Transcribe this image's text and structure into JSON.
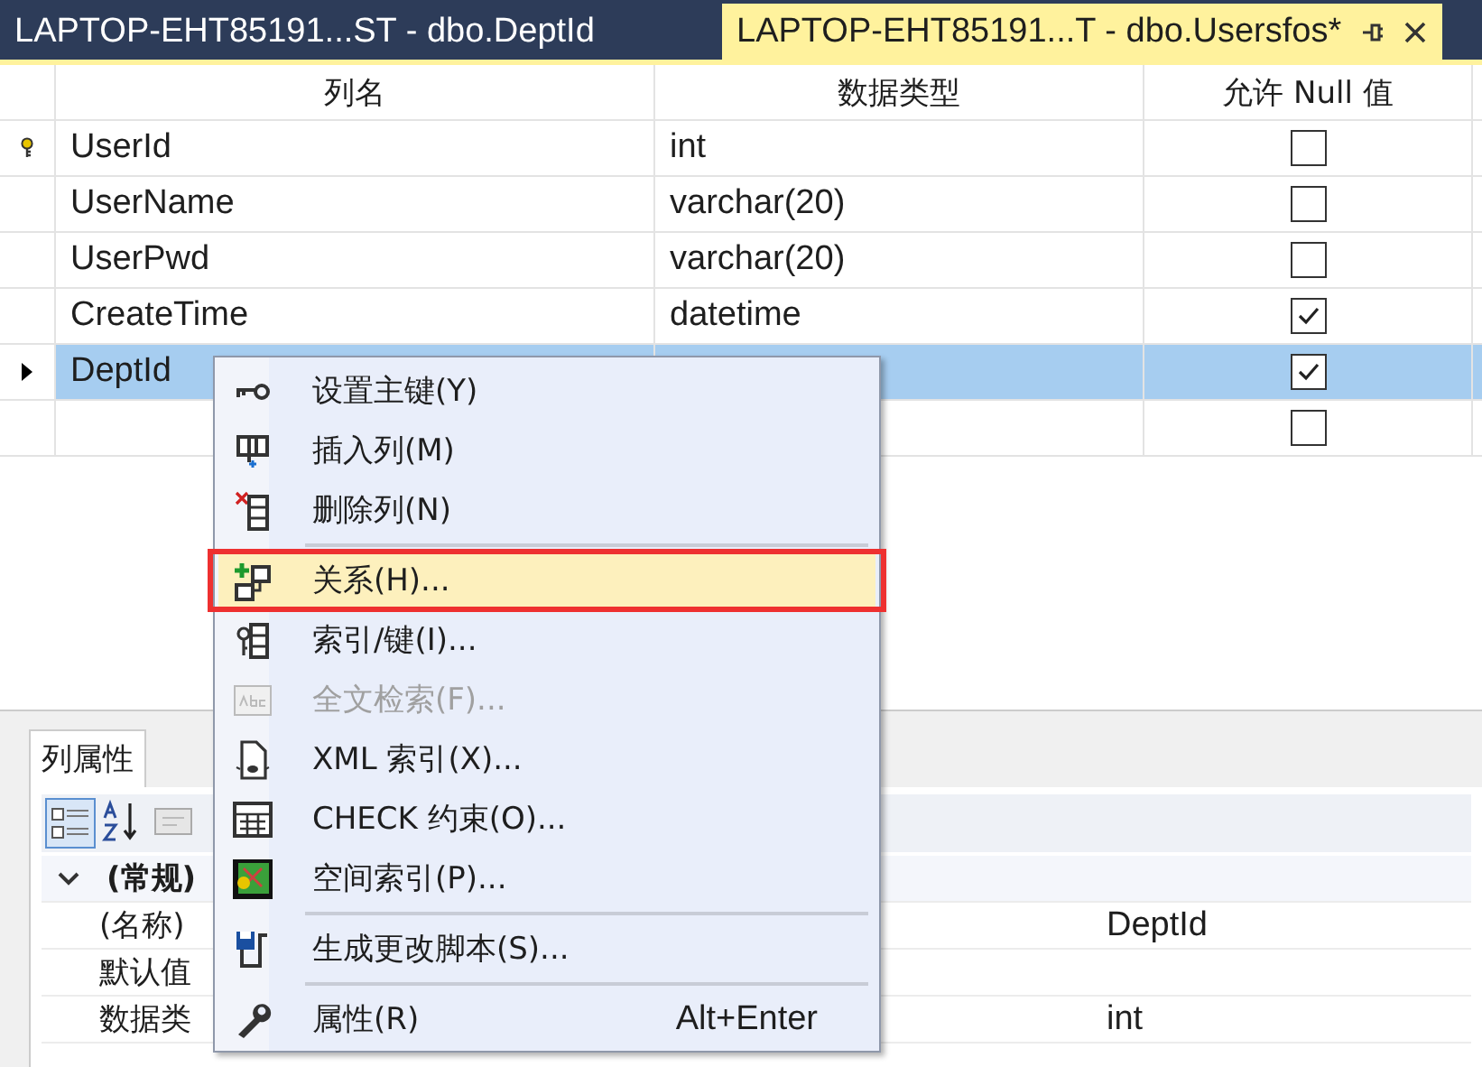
{
  "tabs": [
    {
      "label": "LAPTOP-EHT85191...ST - dbo.DeptId",
      "selected": false
    },
    {
      "label": "LAPTOP-EHT85191...T - dbo.Usersfos*",
      "selected": true
    }
  ],
  "table": {
    "columns": [
      "列名",
      "数据类型",
      "允许 Null 值"
    ],
    "rows": [
      {
        "name": "UserId",
        "type": "int",
        "allow_null": false,
        "primary_key": true,
        "current": false,
        "selected": false
      },
      {
        "name": "UserName",
        "type": "varchar(20)",
        "allow_null": false,
        "primary_key": false,
        "current": false,
        "selected": false
      },
      {
        "name": "UserPwd",
        "type": "varchar(20)",
        "allow_null": false,
        "primary_key": false,
        "current": false,
        "selected": false
      },
      {
        "name": "CreateTime",
        "type": "datetime",
        "allow_null": true,
        "primary_key": false,
        "current": false,
        "selected": false
      },
      {
        "name": "DeptId",
        "allow_null": true,
        "primary_key": false,
        "current": true,
        "selected": true
      },
      {
        "allow_null": false,
        "primary_key": false,
        "current": false,
        "selected": false
      }
    ]
  },
  "properties": {
    "tab": "列属性",
    "rows": [
      {
        "kind": "category",
        "label": "(常规)",
        "expanded": true
      },
      {
        "kind": "property",
        "label": "(名称)",
        "value": "DeptId"
      },
      {
        "kind": "property",
        "label": "默认值"
      },
      {
        "kind": "property",
        "label": "数据类",
        "value": "int"
      }
    ]
  },
  "context_menu": {
    "items": [
      {
        "kind": "item",
        "label": "设置主键(Y)",
        "disabled": false,
        "highlighted": false,
        "outlined": false
      },
      {
        "kind": "item",
        "label": "插入列(M)",
        "disabled": false,
        "highlighted": false,
        "outlined": false
      },
      {
        "kind": "item",
        "label": "删除列(N)",
        "disabled": false,
        "highlighted": false,
        "outlined": false
      },
      {
        "kind": "separator"
      },
      {
        "kind": "item",
        "label": "关系(H)...",
        "disabled": false,
        "highlighted": true,
        "outlined": true
      },
      {
        "kind": "item",
        "label": "索引/键(I)...",
        "disabled": false,
        "highlighted": false,
        "outlined": false
      },
      {
        "kind": "item",
        "label": "全文检索(F)...",
        "disabled": true,
        "highlighted": false,
        "outlined": false
      },
      {
        "kind": "item",
        "label": "XML 索引(X)...",
        "disabled": false,
        "highlighted": false,
        "outlined": false
      },
      {
        "kind": "item",
        "label": "CHECK 约束(O)...",
        "disabled": false,
        "highlighted": false,
        "outlined": false
      },
      {
        "kind": "item",
        "label": "空间索引(P)...",
        "disabled": false,
        "highlighted": false,
        "outlined": false
      },
      {
        "kind": "separator"
      },
      {
        "kind": "item",
        "label": "生成更改脚本(S)...",
        "disabled": false,
        "highlighted": false,
        "outlined": false
      },
      {
        "kind": "separator"
      },
      {
        "kind": "item",
        "label": "属性(R)",
        "shortcut": "Alt+Enter",
        "disabled": false,
        "highlighted": false,
        "outlined": false
      }
    ]
  }
}
